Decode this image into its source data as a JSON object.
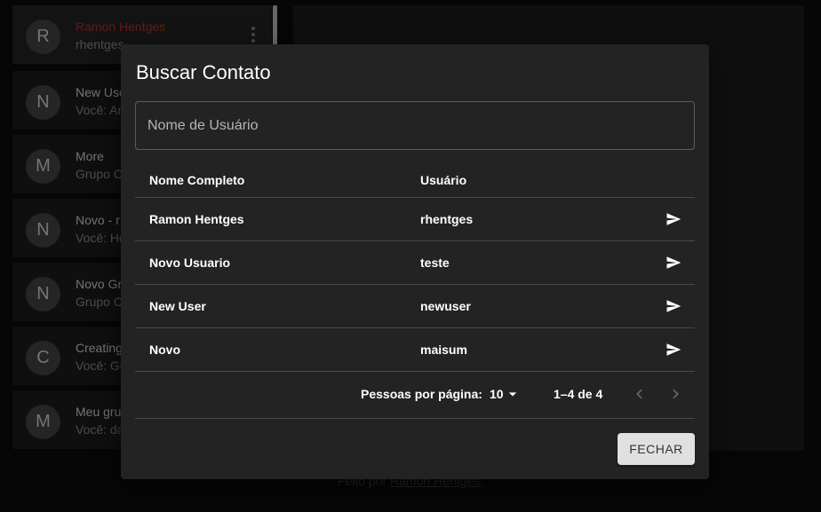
{
  "sidebar": {
    "conversations": [
      {
        "initial": "R",
        "title": "Ramon Hentges",
        "subtitle": "rhentges"
      },
      {
        "initial": "N",
        "title": "New Use",
        "subtitle": "Você: An"
      },
      {
        "initial": "M",
        "title": "More",
        "subtitle": "Grupo C"
      },
      {
        "initial": "N",
        "title": "Novo - r",
        "subtitle": "Você: He"
      },
      {
        "initial": "N",
        "title": "Novo Gr",
        "subtitle": "Grupo C"
      },
      {
        "initial": "C",
        "title": "Creating",
        "subtitle": "Você: Gr"
      },
      {
        "initial": "M",
        "title": "Meu gru",
        "subtitle": "Você: da"
      }
    ]
  },
  "footer": {
    "prefix": "Feito por ",
    "link": "Ramon Hentges",
    "suffix": "."
  },
  "dialog": {
    "title": "Buscar Contato",
    "search_placeholder": "Nome de Usuário",
    "search_value": "",
    "columns": {
      "name": "Nome Completo",
      "username": "Usuário"
    },
    "rows": [
      {
        "name": "Ramon Hentges",
        "username": "rhentges"
      },
      {
        "name": "Novo Usuario",
        "username": "teste"
      },
      {
        "name": "New User",
        "username": "newuser"
      },
      {
        "name": "Novo",
        "username": "maisum"
      }
    ],
    "pagination": {
      "rows_per_page_label": "Pessoas por página:",
      "rows_per_page": "10",
      "range": "1–4 de 4"
    },
    "close_label": "FECHAR"
  },
  "colors": {
    "active_title": "#c0392b",
    "dialog_bg": "#232323",
    "button_bg": "#e0e0e0"
  },
  "icons": {
    "send": "send-icon",
    "menu": "more-vert-icon",
    "prev": "chevron-left-icon",
    "next": "chevron-right-icon",
    "dropdown": "arrow-drop-down-icon"
  }
}
